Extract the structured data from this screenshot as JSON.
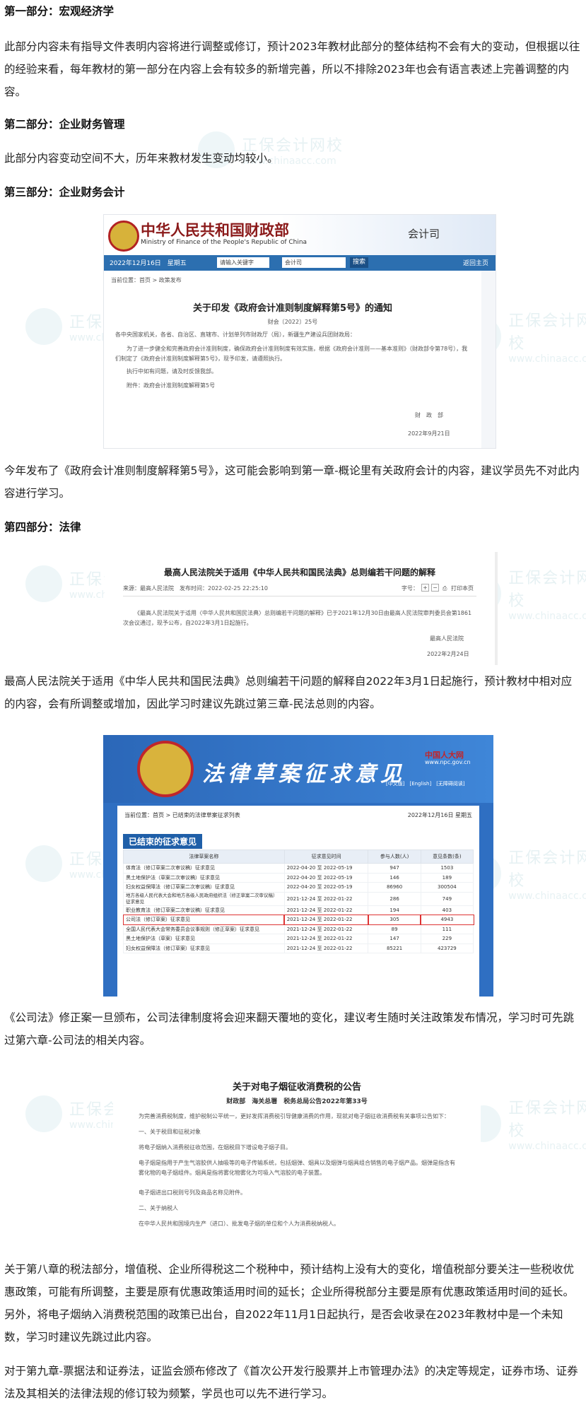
{
  "sections": {
    "s1": {
      "heading": "第一部分：宏观经济学",
      "para": "此部分内容未有指导文件表明内容将进行调整或修订，预计2023年教材此部分的整体结构不会有大的变动，但根据以往的经验来看，每年教材的第一部分在内容上会有较多的新增完善，所以不排除2023年也会有语言表述上完善调整的内容。"
    },
    "s2": {
      "heading": "第二部分：企业财务管理",
      "para": "此部分内容变动空间不大，历年来教材发生变动均较小。"
    },
    "s3": {
      "heading": "第三部分：企业财务会计",
      "para": "今年发布了《政府会计准则制度解释第5号》，这可能会影响到第一章-概论里有关政府会计的内容，建议学员先不对此内容进行学习。"
    },
    "s4": {
      "heading": "第四部分：法律",
      "para1": "最高人民法院关于适用《中华人民共和国民法典》总则编若干问题的解释自2022年3月1日起施行，预计教材中相对应的内容，会有所调整或增加，因此学习时建议先跳过第三章-民法总则的内容。",
      "para2": "《公司法》修正案一旦颁布，公司法律制度将会迎来翻天覆地的变化，建议考生随时关注政策发布情况，学习时可先跳过第六章-公司法的相关内容。",
      "para3": "关于第八章的税法部分，增值税、企业所得税这二个税种中，预计结构上没有大的变化，增值税部分要关注一些税收优惠政策，可能有所调整，主要是原有优惠政策适用时间的延长；企业所得税部分主要是原有优惠政策适用时间的延长。另外，将电子烟纳入消费税范围的政策已出台，自2022年11月1日起执行，是否会收录在2023年教材中是一个未知数，学习时建议先跳过此内容。",
      "para4": "对于第九章-票据法和证券法，证监会颁布修改了《首次公开发行股票并上市管理办法》的决定等规定，证券市场、证券法及其相关的法律法规的修订较为频繁，学员也可以先不进行学习。"
    }
  },
  "watermark": {
    "name": "正保会计网校",
    "url": "www.chinaacc.com"
  },
  "shot_mof": {
    "site_cn": "中华人民共和国财政部",
    "site_en": "Ministry of Finance of the People's Republic of China",
    "dept": "会计司",
    "date": "2022年12月16日　星期五",
    "search_placeholder": "请输入关键字",
    "search_scope": "会计司",
    "search_btn": "搜索",
    "return": "返回主页",
    "crumb": "当前位置：首页 > 政策发布",
    "title": "关于印发《政府会计准则制度解释第5号》的通知",
    "docno": "财会〔2022〕25号",
    "addressee": "各中央国家机关，各省、自治区、直辖市、计划单列市财政厅（局），新疆生产建设兵团财政局：",
    "body": "为了进一步健全和完善政府会计准则制度，确保政府会计准则制度有效实施，根据《政府会计准则——基本准则》（财政部令第78号），我们制定了《政府会计准则制度解释第5号》，现予印发，请遵照执行。",
    "contact": "执行中如有问题，请及时反馈我部。",
    "attachment": "附件：政府会计准则制度解释第5号",
    "signer": "财　政　部",
    "sign_date": "2022年9月21日"
  },
  "shot_court": {
    "title": "最高人民法院关于适用《中华人民共和国民法典》总则编若干问题的解释",
    "source": "来源：最高人民法院　发布时间：2022-02-25 22:25:10",
    "font_label": "字号：",
    "print": "打印本页",
    "body": "《最高人民法院关于适用〈中华人民共和国民法典〉总则编若干问题的解释》已于2021年12月30日由最高人民法院审判委员会第1861次会议通过，现予公布，自2022年3月1日起施行。",
    "signer": "最高人民法院",
    "sign_date": "2022年2月24日"
  },
  "shot_npc": {
    "title": "法律草案征求意见",
    "logo": "中国人大网",
    "url": "www.npc.gov.cn",
    "links": "[中文版]　[English]　[无障碍阅读]",
    "crumb": "当前位置：首页 > 已结束的法律草案征求列表",
    "date": "2022年12月16日 星期五",
    "section": "已结束的征求意见",
    "headers": [
      "法律草案名称",
      "征求意见时间",
      "参与人数(人)",
      "意见条数(条)"
    ],
    "rows": [
      [
        "体育法（修订草案二次审议稿）征求意见",
        "2022-04-20 至 2022-05-19",
        "947",
        "1503"
      ],
      [
        "黑土地保护法（草案二次审议稿）征求意见",
        "2022-04-20 至 2022-05-19",
        "146",
        "189"
      ],
      [
        "妇女权益保障法（修订草案二次审议稿）征求意见",
        "2022-04-20 至 2022-05-19",
        "86960",
        "300504"
      ],
      [
        "地方各级人民代表大会和地方各级人民政府组织法（修正草案二次审议稿）征求意见",
        "2021-12-24 至 2022-01-22",
        "286",
        "749"
      ],
      [
        "职业教育法（修订草案二次审议稿）征求意见",
        "2021-12-24 至 2022-01-22",
        "194",
        "403"
      ],
      [
        "公司法（修订草案）征求意见",
        "2021-12-24 至 2022-01-22",
        "305",
        "4943"
      ],
      [
        "全国人民代表大会常务委员会议事规则（修正草案）征求意见",
        "2021-12-24 至 2022-01-22",
        "89",
        "111"
      ],
      [
        "黑土地保护法（草案）征求意见",
        "2021-12-24 至 2022-01-22",
        "147",
        "229"
      ],
      [
        "妇女权益保障法（修订草案）征求意见",
        "2021-12-24 至 2022-01-22",
        "85221",
        "423729"
      ]
    ]
  },
  "shot_tax": {
    "title": "关于对电子烟征收消费税的公告",
    "sub": "财政部　海关总署　税务总局公告2022年第33号",
    "intro": "为完善消费税制度，维护税制公平统一，更好发挥消费税引导健康消费的作用，现就对电子烟征收消费税有关事项公告如下：",
    "h1": "一、关于税目和征税对象",
    "p1": "将电子烟纳入消费税征收范围，在烟税目下增设电子烟子目。",
    "p2": "电子烟是指用于产生气溶胶供人抽吸等的电子传输系统，包括烟弹、烟具以及烟弹与烟具组合销售的电子烟产品。烟弹是指含有雾化物的电子烟组件。烟具是指将雾化物雾化为可吸入气溶胶的电子装置。",
    "p3": "电子烟进出口税则号列及商品名称见附件。",
    "h2": "二、关于纳税人",
    "p4": "在中华人民共和国境内生产（进口）、批发电子烟的单位和个人为消费税纳税人。"
  }
}
